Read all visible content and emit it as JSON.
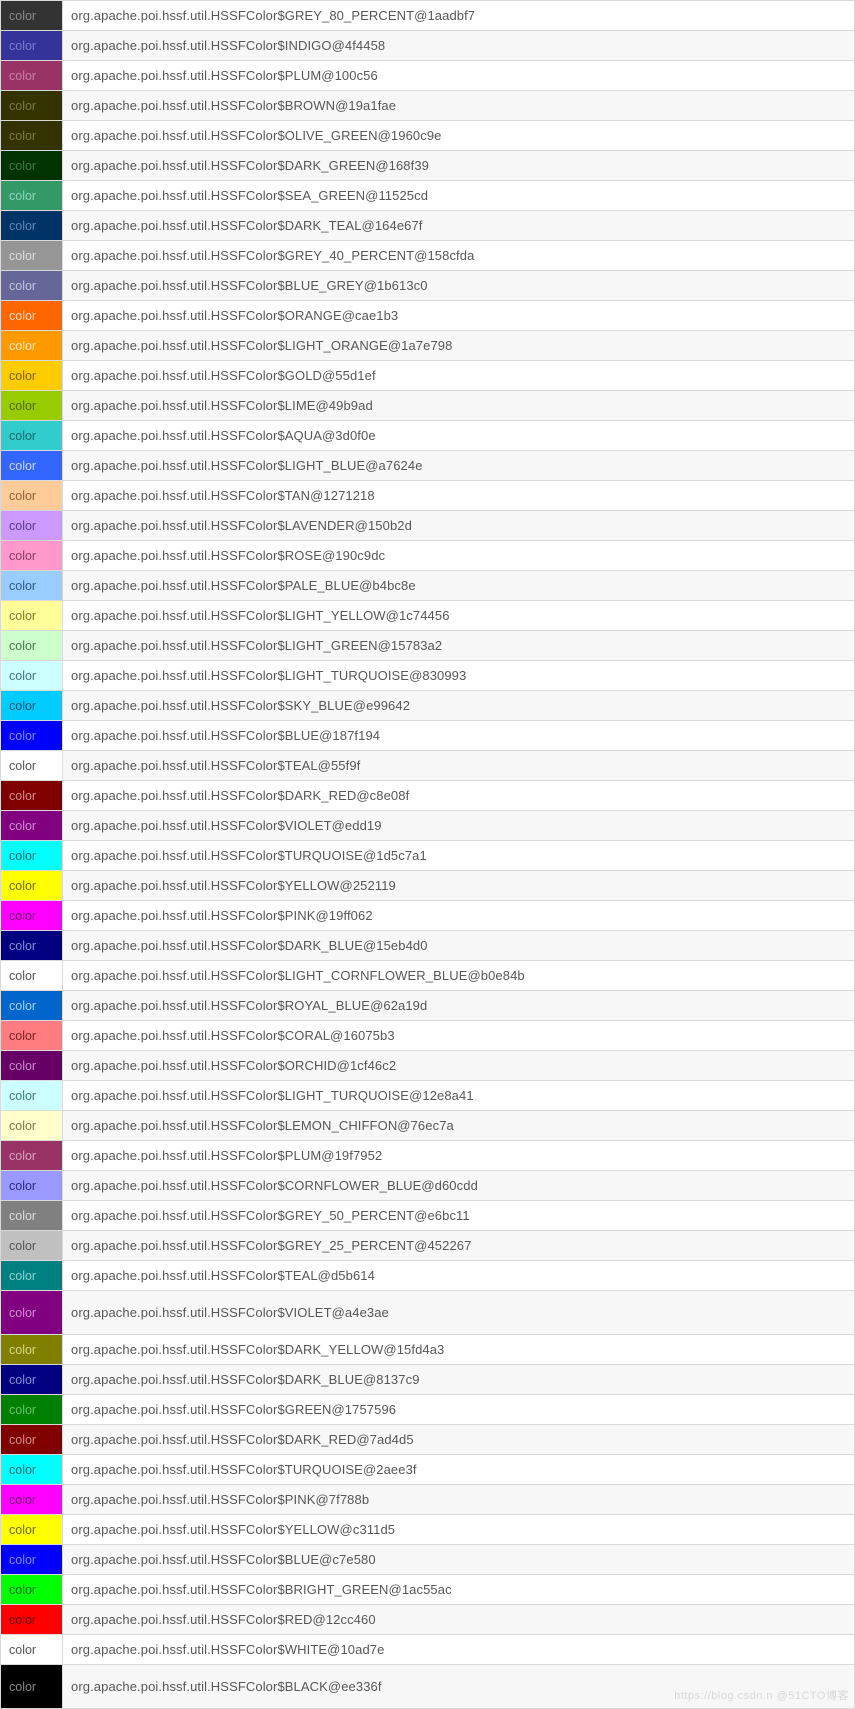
{
  "swatch_label": "color",
  "watermark": "https://blog.csdn.n @51CTO博客",
  "rows": [
    {
      "color": "#333333",
      "text_color": "#8a8a8a",
      "value": "org.apache.poi.hssf.util.HSSFColor$GREY_80_PERCENT@1aadbf7"
    },
    {
      "color": "#333399",
      "text_color": "#7a7ad0",
      "value": "org.apache.poi.hssf.util.HSSFColor$INDIGO@4f4458"
    },
    {
      "color": "#993366",
      "text_color": "#c97fa6",
      "value": "org.apache.poi.hssf.util.HSSFColor$PLUM@100c56"
    },
    {
      "color": "#333300",
      "text_color": "#7a7a44",
      "value": "org.apache.poi.hssf.util.HSSFColor$BROWN@19a1fae"
    },
    {
      "color": "#333300",
      "text_color": "#7a7a44",
      "value": "org.apache.poi.hssf.util.HSSFColor$OLIVE_GREEN@1960c9e"
    },
    {
      "color": "#003300",
      "text_color": "#3f7a3f",
      "value": "org.apache.poi.hssf.util.HSSFColor$DARK_GREEN@168f39"
    },
    {
      "color": "#339966",
      "text_color": "#8fd6b8",
      "value": "org.apache.poi.hssf.util.HSSFColor$SEA_GREEN@11525cd"
    },
    {
      "color": "#003366",
      "text_color": "#5a8ab8",
      "value": "org.apache.poi.hssf.util.HSSFColor$DARK_TEAL@164e67f"
    },
    {
      "color": "#969696",
      "text_color": "#dcdcdc",
      "value": "org.apache.poi.hssf.util.HSSFColor$GREY_40_PERCENT@158cfda"
    },
    {
      "color": "#666699",
      "text_color": "#c4c4de",
      "value": "org.apache.poi.hssf.util.HSSFColor$BLUE_GREY@1b613c0"
    },
    {
      "color": "#FF6600",
      "text_color": "#ffd6b8",
      "value": "org.apache.poi.hssf.util.HSSFColor$ORANGE@cae1b3"
    },
    {
      "color": "#FF9900",
      "text_color": "#ffe6b8",
      "value": "org.apache.poi.hssf.util.HSSFColor$LIGHT_ORANGE@1a7e798"
    },
    {
      "color": "#FFCC00",
      "text_color": "#7a6200",
      "value": "org.apache.poi.hssf.util.HSSFColor$GOLD@55d1ef"
    },
    {
      "color": "#99CC00",
      "text_color": "#506b00",
      "value": "org.apache.poi.hssf.util.HSSFColor$LIME@49b9ad"
    },
    {
      "color": "#33CCCC",
      "text_color": "#0f6b6b",
      "value": "org.apache.poi.hssf.util.HSSFColor$AQUA@3d0f0e"
    },
    {
      "color": "#3366FF",
      "text_color": "#c7d6ff",
      "value": "org.apache.poi.hssf.util.HSSFColor$LIGHT_BLUE@a7624e"
    },
    {
      "color": "#FFCC99",
      "text_color": "#8a6434",
      "value": "org.apache.poi.hssf.util.HSSFColor$TAN@1271218"
    },
    {
      "color": "#CC99FF",
      "text_color": "#5c3a8c",
      "value": "org.apache.poi.hssf.util.HSSFColor$LAVENDER@150b2d"
    },
    {
      "color": "#FF99CC",
      "text_color": "#8a3a64",
      "value": "org.apache.poi.hssf.util.HSSFColor$ROSE@190c9dc"
    },
    {
      "color": "#99CCFF",
      "text_color": "#2a5b8c",
      "value": "org.apache.poi.hssf.util.HSSFColor$PALE_BLUE@b4bc8e"
    },
    {
      "color": "#FFFF99",
      "text_color": "#7a7a30",
      "value": "org.apache.poi.hssf.util.HSSFColor$LIGHT_YELLOW@1c74456"
    },
    {
      "color": "#CCFFCC",
      "text_color": "#497a49",
      "value": "org.apache.poi.hssf.util.HSSFColor$LIGHT_GREEN@15783a2"
    },
    {
      "color": "#CCFFFF",
      "text_color": "#3a7a7a",
      "value": "org.apache.poi.hssf.util.HSSFColor$LIGHT_TURQUOISE@830993"
    },
    {
      "color": "#00CCFF",
      "text_color": "#005570",
      "value": "org.apache.poi.hssf.util.HSSFColor$SKY_BLUE@e99642"
    },
    {
      "color": "#0000FF",
      "text_color": "#8a8aff",
      "value": "org.apache.poi.hssf.util.HSSFColor$BLUE@187f194"
    },
    {
      "color": "#ffffff",
      "text_color": "#555",
      "value": "org.apache.poi.hssf.util.HSSFColor$TEAL@55f9f"
    },
    {
      "color": "#800000",
      "text_color": "#d48a8a",
      "value": "org.apache.poi.hssf.util.HSSFColor$DARK_RED@c8e08f"
    },
    {
      "color": "#800080",
      "text_color": "#d48ad4",
      "value": "org.apache.poi.hssf.util.HSSFColor$VIOLET@edd19"
    },
    {
      "color": "#00FFFF",
      "text_color": "#006b6b",
      "value": "org.apache.poi.hssf.util.HSSFColor$TURQUOISE@1d5c7a1"
    },
    {
      "color": "#FFFF00",
      "text_color": "#6b6b00",
      "value": "org.apache.poi.hssf.util.HSSFColor$YELLOW@252119"
    },
    {
      "color": "#FF00FF",
      "text_color": "#7a007a",
      "value": "org.apache.poi.hssf.util.HSSFColor$PINK@19ff062"
    },
    {
      "color": "#000080",
      "text_color": "#8a8ad4",
      "value": "org.apache.poi.hssf.util.HSSFColor$DARK_BLUE@15eb4d0"
    },
    {
      "color": "#ffffff",
      "text_color": "#555",
      "value": "org.apache.poi.hssf.util.HSSFColor$LIGHT_CORNFLOWER_BLUE@b0e84b"
    },
    {
      "color": "#0066CC",
      "text_color": "#a8d0f5",
      "value": "org.apache.poi.hssf.util.HSSFColor$ROYAL_BLUE@62a19d"
    },
    {
      "color": "#FF7C80",
      "text_color": "#7a1f23",
      "value": "org.apache.poi.hssf.util.HSSFColor$CORAL@16075b3"
    },
    {
      "color": "#660066",
      "text_color": "#c98ac9",
      "value": "org.apache.poi.hssf.util.HSSFColor$ORCHID@1cf46c2"
    },
    {
      "color": "#CCFFFF",
      "text_color": "#3a7a7a",
      "value": "org.apache.poi.hssf.util.HSSFColor$LIGHT_TURQUOISE@12e8a41"
    },
    {
      "color": "#FFFFCC",
      "text_color": "#7a7a49",
      "value": "org.apache.poi.hssf.util.HSSFColor$LEMON_CHIFFON@76ec7a"
    },
    {
      "color": "#993366",
      "text_color": "#d6a4be",
      "value": "org.apache.poi.hssf.util.HSSFColor$PLUM@19f7952"
    },
    {
      "color": "#9999FF",
      "text_color": "#2a2a8c",
      "value": "org.apache.poi.hssf.util.HSSFColor$CORNFLOWER_BLUE@d60cdd"
    },
    {
      "color": "#808080",
      "text_color": "#dcdcdc",
      "value": "org.apache.poi.hssf.util.HSSFColor$GREY_50_PERCENT@e6bc11"
    },
    {
      "color": "#C0C0C0",
      "text_color": "#555",
      "value": "org.apache.poi.hssf.util.HSSFColor$GREY_25_PERCENT@452267"
    },
    {
      "color": "#008080",
      "text_color": "#8ad4d4",
      "value": "org.apache.poi.hssf.util.HSSFColor$TEAL@d5b614"
    },
    {
      "color": "#800080",
      "text_color": "#d48ad4",
      "value": "org.apache.poi.hssf.util.HSSFColor$VIOLET@a4e3ae",
      "tall": true
    },
    {
      "color": "#808000",
      "text_color": "#d6d68a",
      "value": "org.apache.poi.hssf.util.HSSFColor$DARK_YELLOW@15fd4a3"
    },
    {
      "color": "#000080",
      "text_color": "#8a8ad4",
      "value": "org.apache.poi.hssf.util.HSSFColor$DARK_BLUE@8137c9"
    },
    {
      "color": "#008000",
      "text_color": "#66c266",
      "value": "org.apache.poi.hssf.util.HSSFColor$GREEN@1757596"
    },
    {
      "color": "#800000",
      "text_color": "#d48a8a",
      "value": "org.apache.poi.hssf.util.HSSFColor$DARK_RED@7ad4d5"
    },
    {
      "color": "#00FFFF",
      "text_color": "#006b6b",
      "value": "org.apache.poi.hssf.util.HSSFColor$TURQUOISE@2aee3f"
    },
    {
      "color": "#FF00FF",
      "text_color": "#7a007a",
      "value": "org.apache.poi.hssf.util.HSSFColor$PINK@7f788b"
    },
    {
      "color": "#FFFF00",
      "text_color": "#6b6b00",
      "value": "org.apache.poi.hssf.util.HSSFColor$YELLOW@c311d5"
    },
    {
      "color": "#0000FF",
      "text_color": "#8a8aff",
      "value": "org.apache.poi.hssf.util.HSSFColor$BLUE@c7e580"
    },
    {
      "color": "#00FF00",
      "text_color": "#006b00",
      "value": "org.apache.poi.hssf.util.HSSFColor$BRIGHT_GREEN@1ac55ac"
    },
    {
      "color": "#FF0000",
      "text_color": "#6b0000",
      "value": "org.apache.poi.hssf.util.HSSFColor$RED@12cc460"
    },
    {
      "color": "#FFFFFF",
      "text_color": "#555",
      "value": "org.apache.poi.hssf.util.HSSFColor$WHITE@10ad7e"
    },
    {
      "color": "#000000",
      "text_color": "#888",
      "value": "org.apache.poi.hssf.util.HSSFColor$BLACK@ee336f",
      "tall": true
    }
  ]
}
